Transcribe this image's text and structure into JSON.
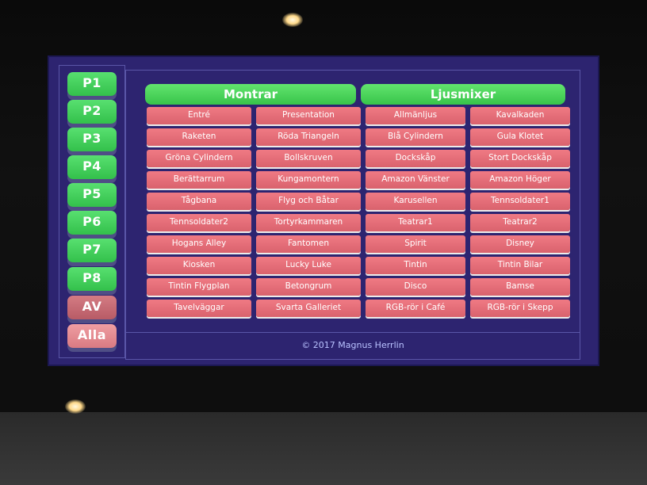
{
  "sidebar": {
    "buttons": [
      {
        "label": "P1",
        "color": "green"
      },
      {
        "label": "P2",
        "color": "green"
      },
      {
        "label": "P3",
        "color": "green"
      },
      {
        "label": "P4",
        "color": "green"
      },
      {
        "label": "P5",
        "color": "green"
      },
      {
        "label": "P6",
        "color": "green"
      },
      {
        "label": "P7",
        "color": "green"
      },
      {
        "label": "P8",
        "color": "green"
      },
      {
        "label": "AV",
        "color": "red"
      },
      {
        "label": "Alla",
        "color": "pink"
      }
    ]
  },
  "headers": {
    "left": "Montrar",
    "right": "Ljusmixer"
  },
  "grid": [
    [
      "Entré",
      "Presentation",
      "Allmänljus",
      "Kavalkaden"
    ],
    [
      "Raketen",
      "Röda Triangeln",
      "Blå Cylindern",
      "Gula Klotet"
    ],
    [
      "Gröna Cylindern",
      "Bollskruven",
      "Dockskåp",
      "Stort Dockskåp"
    ],
    [
      "Berättarrum",
      "Kungamontern",
      "Amazon Vänster",
      "Amazon Höger"
    ],
    [
      "Tågbana",
      "Flyg och Båtar",
      "Karusellen",
      "Tennsoldater1"
    ],
    [
      "Tennsoldater2",
      "Tortyrkammaren",
      "Teatrar1",
      "Teatrar2"
    ],
    [
      "Hogans Alley",
      "Fantomen",
      "Spirit",
      "Disney"
    ],
    [
      "Kiosken",
      "Lucky Luke",
      "Tintin",
      "Tintin Bilar"
    ],
    [
      "Tintin Flygplan",
      "Betongrum",
      "Disco",
      "Bamse"
    ],
    [
      "Tavelväggar",
      "Svarta Galleriet",
      "RGB-rör i Café",
      "RGB-rör i Skepp"
    ]
  ],
  "footer": "© 2017 Magnus Herrlin",
  "colors": {
    "screen_bg": "#2d2470",
    "green_button": "#3fcb55",
    "red_button": "#c76a74",
    "pink_button": "#e68b91",
    "grid_button": "#e56c76",
    "footer_text": "#b9c2ff"
  }
}
